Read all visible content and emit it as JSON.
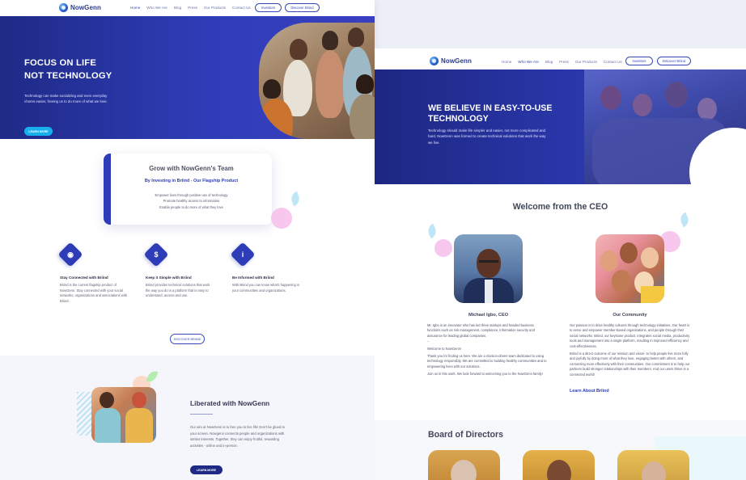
{
  "brand": {
    "name": "NowGenn",
    "color_primary": "#2e3db7",
    "color_navy": "#1f2a86",
    "color_cyan": "#17b0ec",
    "accent_pink": "#f6c0e6",
    "accent_cyan": "#bfe6f6"
  },
  "left_page": {
    "nav": {
      "links": [
        "Home",
        "Who We Are",
        "Blog",
        "Press",
        "Our Products",
        "Contact Us"
      ],
      "active": "Home",
      "investors_label": "Investors",
      "discover_label": "Discover Briind"
    },
    "hero": {
      "title_line1": "FOCUS ON LIFE",
      "title_line2": "NOT TECHNOLOGY",
      "text": "Technology can make socializing and even everyday chores easier, freeing us to do more of what we love.",
      "button_label": "LEARN MORE"
    },
    "grow": {
      "title": "Grow with NowGenn's Team",
      "subtitle": "By Investing in Briind - Our Flagship Product",
      "bullets": [
        "Empower lives through positive use of technology",
        "Promote healthy access to information",
        "Enable people to do more of what they love"
      ]
    },
    "features": [
      {
        "icon": "wifi-icon",
        "glyph": "◉",
        "title": "Stay Connected with Briind",
        "text": "Briind is the current flagship product of NowGenn. Stay connected with your social networks, organizations and associations with Briind."
      },
      {
        "icon": "dollar-icon",
        "glyph": "$",
        "title": "Keep it Simple with Briind",
        "text": "Briind provides technical solutions that work the way you do in a platform that is easy to understand, access and use."
      },
      {
        "icon": "info-icon",
        "glyph": "i",
        "title": "Be Informed with Briind",
        "text": "With Briind you can know what's happening in your communities and organizations."
      }
    ],
    "discover_button": "DISCOVER BRIIND",
    "liberated": {
      "title": "Liberated with NowGenn",
      "text": "Our aim at NowGenn is to free you to live life! Don't be glued to your screen. Nowgenn connects people and organizations with similar interests. Together, they can enjoy fruitful, rewarding activities - online and in-person.",
      "button_label": "LEARN MORE"
    }
  },
  "right_page": {
    "nav": {
      "links": [
        "Home",
        "Who We Are",
        "Blog",
        "Press",
        "Our Products",
        "Contact Us"
      ],
      "active": "Who We Are",
      "investors_label": "Investors",
      "discover_label": "Discover Briind"
    },
    "hero": {
      "title_line1": "WE BELIEVE IN EASY-TO-USE",
      "title_line2": "TECHNOLOGY",
      "text": "Technology should make life simpler and easier, not more complicated and hard. NowGenn was formed to create technical solutions that work the way we live."
    },
    "ceo_section_title": "Welcome from the CEO",
    "ceo": {
      "caption": "Michael Igbo, CEO",
      "para1": "Mr. Igbo is an innovator who has led three startups and headed business functions such as risk management, compliance, information security and assurance for leading global companies.",
      "para2": "...",
      "para3": "Welcome to NowGenn!",
      "para4": "Thank you for finding us here. We are a mission-driven team dedicated to using technology responsibly. We are committed to building healthy communities and to empowering lives with our solutions.",
      "para5": "Join us in this work. We look forward to welcoming you to the NowGenn family!"
    },
    "community": {
      "caption": "Our Community",
      "para1": "Our passion is to drive healthy cultures through technology initiatives. Our heart is to serve and empower member-based organizations, and people through their social networks. Briind, our keystone product, integrates social media, productivity tools and management into a single platform, resulting in improved efficiency and cost-effectiveness.",
      "para2": "Briind is a direct outcome of our mission and vision- to help people live more fully and joyfully by doing more of what they love, engaging better with others, and connecting more effectively with their communities. Our commitment is to help our partners build stronger relationships with their members. And our users thrive in a connected world!",
      "link": "Learn About Briind"
    },
    "board_title": "Board of Directors"
  }
}
